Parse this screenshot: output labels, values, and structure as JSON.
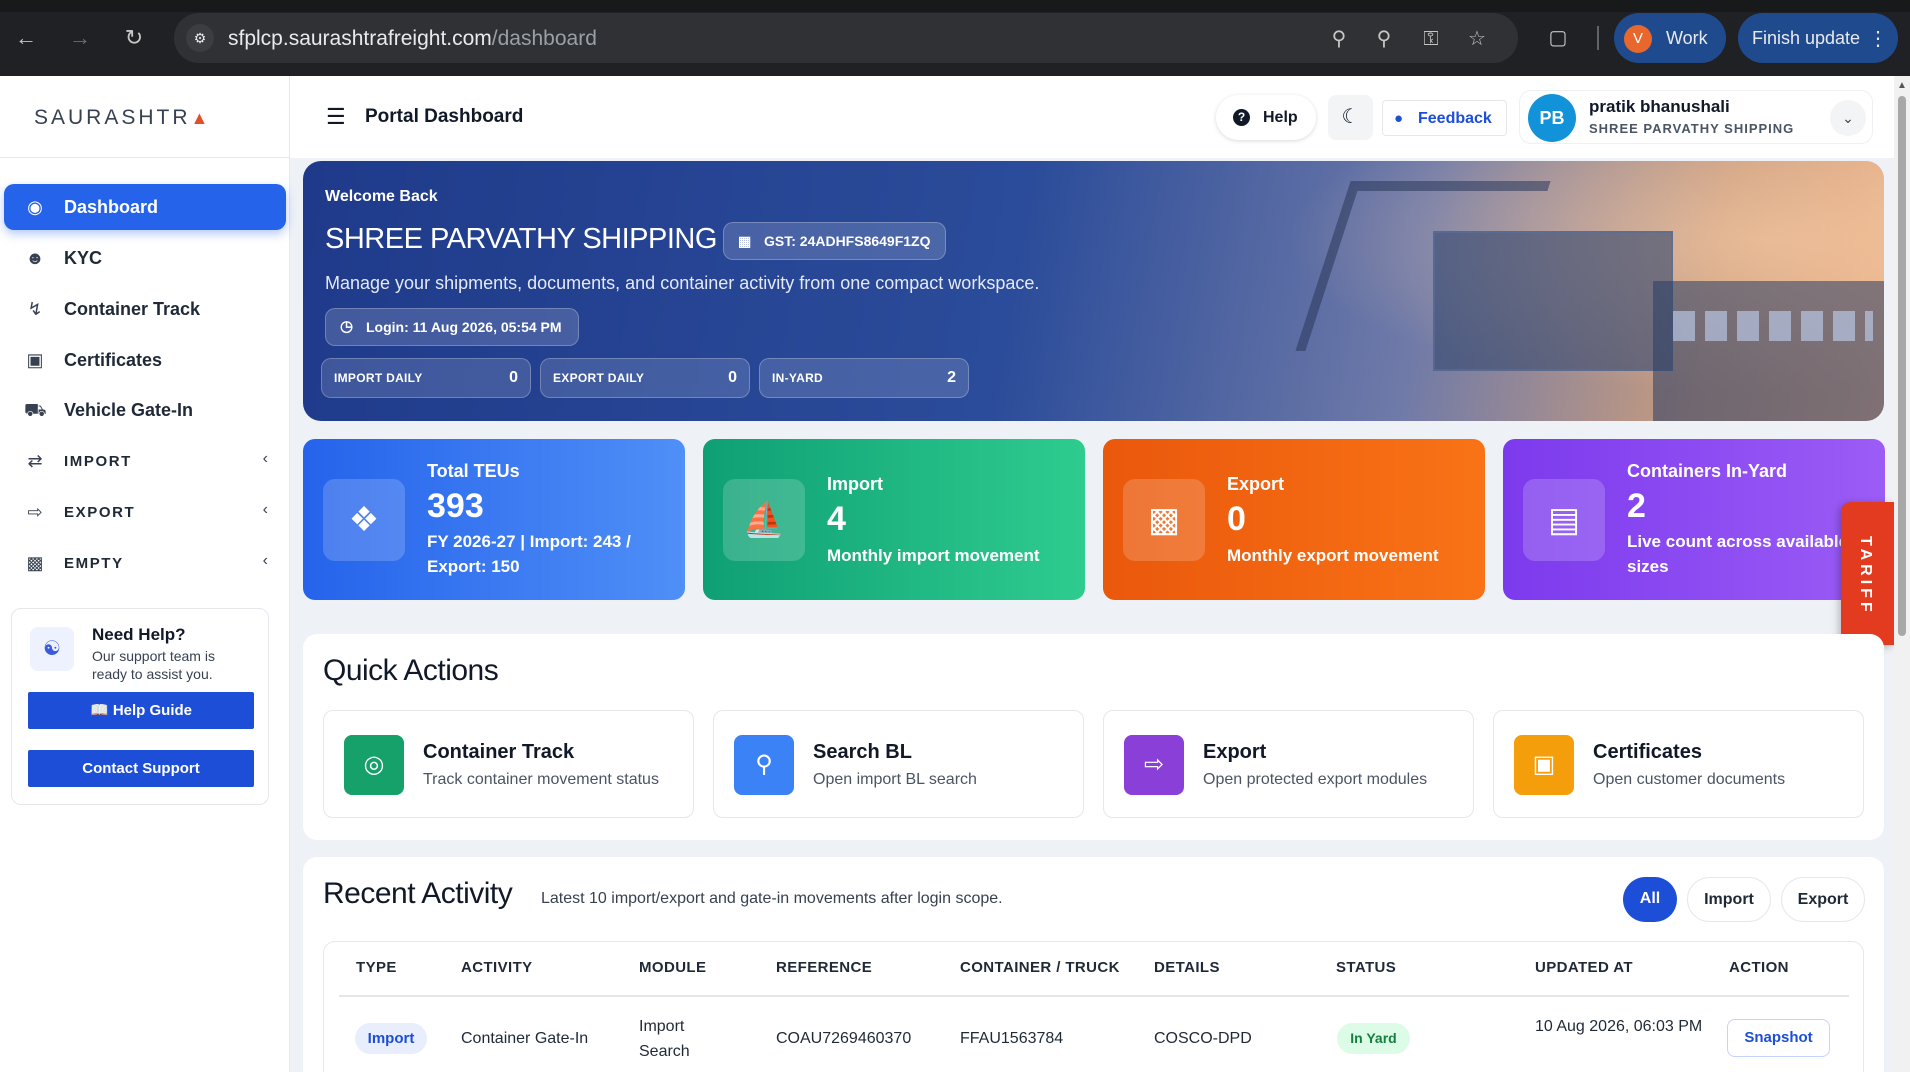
{
  "browser": {
    "url_host": "sfplcp.saurashtrafreight.com",
    "url_path": "/dashboard",
    "profile_initial": "V",
    "profile_label": "Work",
    "update_label": "Finish update"
  },
  "sidebar": {
    "brand": "SAURASHTR",
    "brand_accent": "▲",
    "items": [
      {
        "label": "Dashboard",
        "icon": "dashboard-icon"
      },
      {
        "label": "KYC",
        "icon": "user-icon"
      },
      {
        "label": "Container Track",
        "icon": "route-icon"
      },
      {
        "label": "Certificates",
        "icon": "file-icon"
      },
      {
        "label": "Vehicle Gate-In",
        "icon": "truck-icon"
      },
      {
        "label": "IMPORT",
        "icon": "swap-icon"
      },
      {
        "label": "EXPORT",
        "icon": "export-icon"
      },
      {
        "label": "EMPTY",
        "icon": "dolly-icon"
      }
    ],
    "help": {
      "title": "Need Help?",
      "desc": "Our support team is ready to assist you.",
      "guide_btn": "Help Guide",
      "contact_btn": "Contact Support"
    }
  },
  "topbar": {
    "title": "Portal Dashboard",
    "help": "Help",
    "feedback": "Feedback",
    "user_initials": "PB",
    "user_name": "pratik bhanushali",
    "user_org": "SHREE PARVATHY SHIPPING"
  },
  "hero": {
    "welcome": "Welcome Back",
    "company": "SHREE PARVATHY SHIPPING",
    "gst": "GST: 24ADHFS8649F1ZQ",
    "tagline": "Manage your shipments, documents, and container activity from one compact workspace.",
    "login": "Login: 11 Aug 2026, 05:54 PM",
    "stats": [
      {
        "label": "IMPORT DAILY",
        "value": "0"
      },
      {
        "label": "EXPORT DAILY",
        "value": "0"
      },
      {
        "label": "IN-YARD",
        "value": "2"
      }
    ]
  },
  "metrics": [
    {
      "title": "Total TEUs",
      "value": "393",
      "sub": "FY 2026-27 | Import: 243 / Export: 150",
      "color_from": "#2563eb",
      "color_to": "#4f8ff7"
    },
    {
      "title": "Import",
      "value": "4",
      "sub": "Monthly import movement",
      "color_from": "#0f9f74",
      "color_to": "#2ecc8f"
    },
    {
      "title": "Export",
      "value": "0",
      "sub": "Monthly export movement",
      "color_from": "#ea580c",
      "color_to": "#f97316"
    },
    {
      "title": "Containers In-Yard",
      "value": "2",
      "sub": "Live count across available sizes",
      "color_from": "#7c3aed",
      "color_to": "#9b5cf6"
    }
  ],
  "tariff_label": "TARIFF",
  "quick_actions": {
    "title": "Quick Actions",
    "items": [
      {
        "title": "Container Track",
        "sub": "Track container movement status",
        "icon": "target-icon",
        "color": "#16a06a"
      },
      {
        "title": "Search BL",
        "sub": "Open import BL search",
        "icon": "search-icon",
        "color": "#3b82f6"
      },
      {
        "title": "Export",
        "sub": "Open protected export modules",
        "icon": "export-file-icon",
        "color": "#8b3fd9"
      },
      {
        "title": "Certificates",
        "sub": "Open customer documents",
        "icon": "certificate-icon",
        "color": "#f59e0b"
      }
    ]
  },
  "recent": {
    "title": "Recent Activity",
    "subtitle": "Latest 10 import/export and gate-in movements after login scope.",
    "filters": [
      "All",
      "Import",
      "Export"
    ],
    "columns": [
      "TYPE",
      "ACTIVITY",
      "MODULE",
      "REFERENCE",
      "CONTAINER / TRUCK",
      "DETAILS",
      "STATUS",
      "UPDATED AT",
      "ACTION"
    ],
    "rows": [
      {
        "type": "Import",
        "activity": "Container Gate-In",
        "module": "Import Search",
        "reference": "COAU7269460370",
        "container": "FFAU1563784",
        "details": "COSCO-DPD",
        "status": "In Yard",
        "updated": "10 Aug 2026, 06:03 PM",
        "action": "Snapshot"
      }
    ]
  }
}
